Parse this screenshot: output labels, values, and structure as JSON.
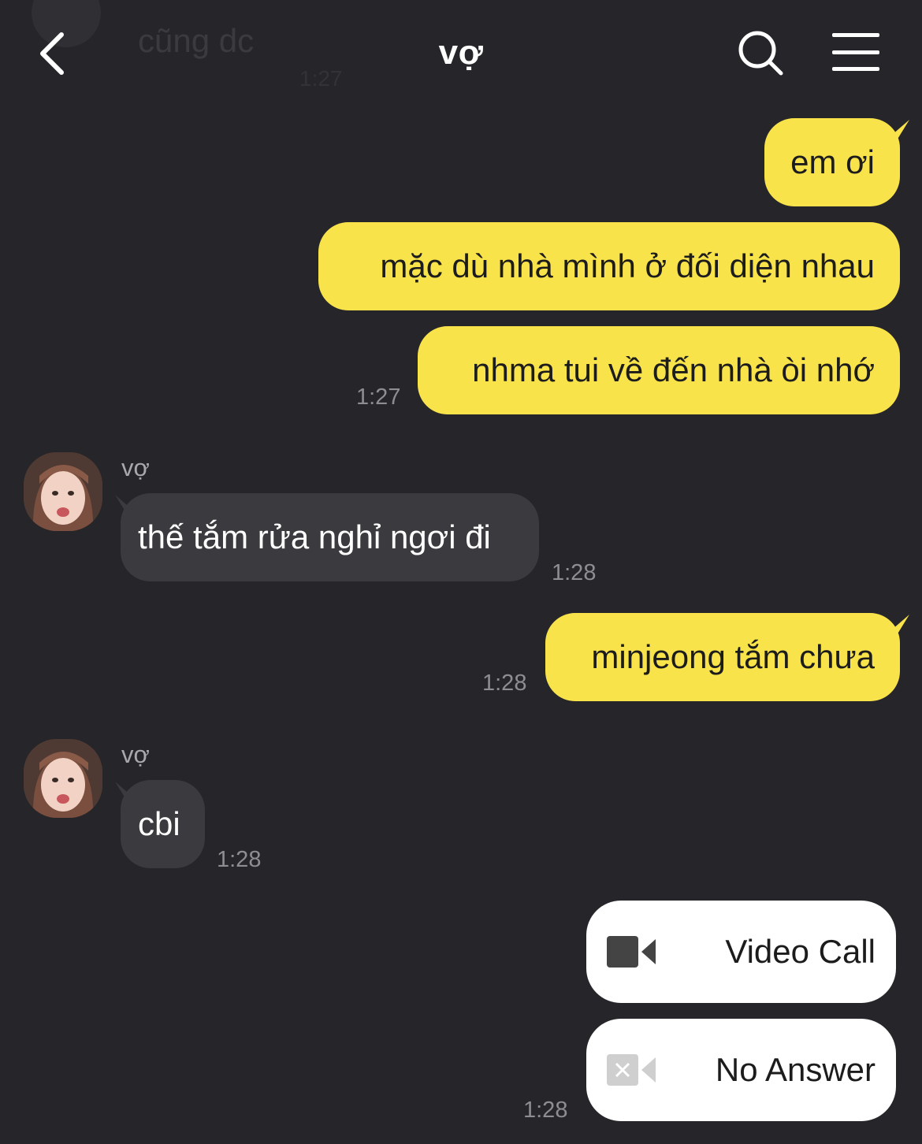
{
  "header": {
    "title": "vợ",
    "back_icon": "chevron-left-icon",
    "search_icon": "search-icon",
    "menu_icon": "hamburger-menu-icon"
  },
  "ghost_message": {
    "text": "cũng dc",
    "time": "1:27"
  },
  "messages": [
    {
      "from": "me",
      "text": "em ơi"
    },
    {
      "from": "me",
      "text": "mặc dù nhà mình ở đối diện nhau"
    },
    {
      "from": "me",
      "text": "nhma tui về đến nhà òi nhớ",
      "time": "1:27"
    },
    {
      "from": "them",
      "sender": "vợ",
      "text": "thế tắm rửa nghỉ ngơi đi",
      "time": "1:28"
    },
    {
      "from": "me",
      "text": "minjeong tắm chưa",
      "time": "1:28"
    },
    {
      "from": "them",
      "sender": "vợ",
      "text": "cbi",
      "time": "1:28"
    }
  ],
  "calls": [
    {
      "label": "Video Call",
      "icon": "video-camera-icon"
    },
    {
      "label": "No Answer",
      "icon": "missed-video-icon",
      "time": "1:28"
    }
  ],
  "colors": {
    "background": "#26262a",
    "my_bubble": "#f9e34a",
    "their_bubble": "#3b3b3f",
    "timestamp": "#8d8d92"
  }
}
